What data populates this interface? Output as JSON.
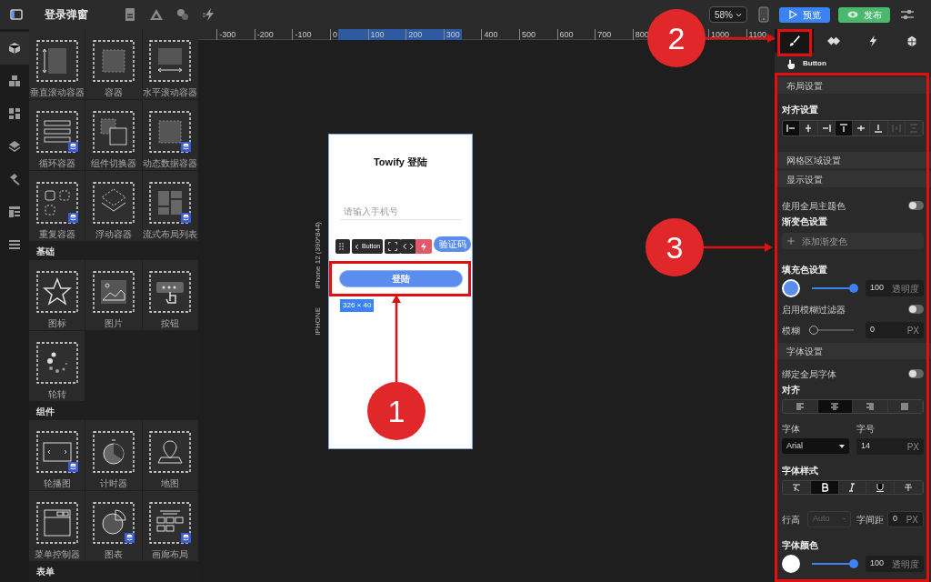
{
  "window": {
    "title": "登录弹窗"
  },
  "toolbar": {
    "zoom": "58%",
    "preview": "预览",
    "publish": "发布"
  },
  "rail": [
    {
      "selected": true
    },
    {
      "selected": false
    },
    {
      "selected": false
    },
    {
      "selected": false
    },
    {
      "selected": false
    },
    {
      "selected": false
    },
    {
      "selected": false
    }
  ],
  "library": [
    {
      "items": [
        {
          "label": "垂直滚动容器",
          "data_source": false
        },
        {
          "label": "容器",
          "data_source": false
        },
        {
          "label": "水平滚动容器",
          "data_source": false
        },
        {
          "label": "循环容器",
          "data_source": true
        },
        {
          "label": "组件切换器",
          "data_source": false
        },
        {
          "label": "动态数据容器",
          "data_source": true
        },
        {
          "label": "重复容器",
          "data_source": true
        },
        {
          "label": "浮动容器",
          "data_source": false
        },
        {
          "label": "流式布局列表",
          "data_source": true
        }
      ]
    },
    {
      "title": "基础",
      "items": [
        {
          "label": "图标",
          "data_source": false
        },
        {
          "label": "图片",
          "data_source": false
        },
        {
          "label": "按钮",
          "data_source": false
        },
        {
          "label": "轮转",
          "data_source": false
        }
      ]
    },
    {
      "title": "组件",
      "items": [
        {
          "label": "轮播图",
          "data_source": true
        },
        {
          "label": "计时器",
          "data_source": false
        },
        {
          "label": "地图",
          "data_source": false
        },
        {
          "label": "菜单控制器",
          "data_source": false
        },
        {
          "label": "图表",
          "data_source": true
        },
        {
          "label": "画廊布局",
          "data_source": true
        }
      ]
    },
    {
      "title": "表单"
    }
  ],
  "ruler": [
    "-300",
    "-200",
    "-100",
    "0",
    "100",
    "200",
    "300",
    "400",
    "500",
    "600",
    "700",
    "800",
    "1000",
    "1100"
  ],
  "canvas": {
    "device_label": "iPhone 12 (390*844)",
    "device_type": "IPHONE",
    "title": "Towify 登陆",
    "phone_placeholder": "请输入手机号",
    "code_button": "验证码",
    "login_button": "登陆",
    "toolbar_label": "Button",
    "size": "326 × 40"
  },
  "inspector": {
    "tabs": [
      {
        "selected": true
      },
      {
        "selected": false
      },
      {
        "selected": false
      },
      {
        "selected": false
      }
    ],
    "component": "Button",
    "layout_header": "布局设置",
    "align_label": "对齐设置",
    "align_buttons": [
      {
        "selected": true,
        "disabled": false
      },
      {
        "selected": false,
        "disabled": false
      },
      {
        "selected": false,
        "disabled": false
      },
      {
        "selected": true,
        "disabled": false
      },
      {
        "selected": false,
        "disabled": false
      },
      {
        "selected": false,
        "disabled": false
      },
      {
        "selected": false,
        "disabled": true
      },
      {
        "selected": false,
        "disabled": true
      }
    ],
    "grid_header": "网格区域设置",
    "display_header": "显示设置",
    "global_theme": {
      "label": "使用全局主题色",
      "on": false
    },
    "gradient_label": "渐变色设置",
    "add_gradient": "添加渐变色",
    "fill_label": "填充色设置",
    "fill": {
      "color": "#5b8def",
      "level": 1,
      "value": "100",
      "unit": "透明度"
    },
    "blur_toggle": {
      "label": "启用模糊过滤器",
      "on": false
    },
    "blur": {
      "label": "模糊",
      "level": 0,
      "value": "0",
      "unit": "PX"
    },
    "font_header": "字体设置",
    "global_font": {
      "label": "绑定全局字体",
      "on": false
    },
    "text_align_label": "对齐",
    "text_align": [
      {
        "selected": false
      },
      {
        "selected": true
      },
      {
        "selected": false
      },
      {
        "selected": false
      }
    ],
    "font_label": "字体",
    "font": "Arial",
    "size_label": "字号",
    "size": {
      "value": "14",
      "unit": "PX"
    },
    "style_label": "字体样式",
    "styles": [
      {
        "selected": false
      },
      {
        "selected": true
      },
      {
        "selected": false
      },
      {
        "selected": false
      },
      {
        "selected": false
      }
    ],
    "line_height": {
      "label": "行高",
      "value": "Auto",
      "caret": "-"
    },
    "letter_spacing": {
      "label": "字间距",
      "value": "0",
      "unit": "PX"
    },
    "font_color_label": "字体颜色",
    "font_color": {
      "color": "#ffffff",
      "level": 1,
      "value": "100",
      "unit": "透明度"
    }
  },
  "annotations": [
    {
      "label": "1"
    },
    {
      "label": "2"
    },
    {
      "label": "3"
    }
  ]
}
